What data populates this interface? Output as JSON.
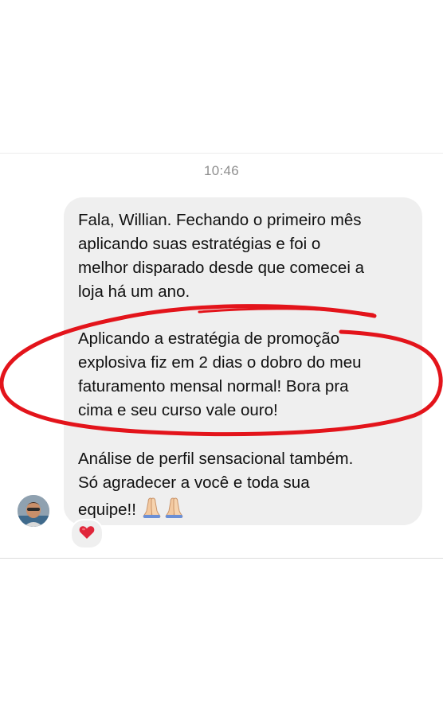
{
  "chat": {
    "timestamp": "10:46",
    "message": {
      "paragraph_1": "Fala, Willian. Fechando o primeiro mês\naplicando suas estratégias e foi o\nmelhor disparado desde que comecei a\nloja há um ano.",
      "paragraph_2": "Aplicando a estratégia de promoção\nexplosiva fiz em 2 dias o dobro do meu\nfaturamento mensal normal! Bora pra\ncima e seu curso vale ouro!",
      "paragraph_3": "Análise de perfil sensacional também.\nSó agradecer a você e toda sua\nequipe!!",
      "emoji_icons": [
        "folded-hands-icon",
        "folded-hands-icon"
      ]
    },
    "reaction": {
      "icon": "red-heart-icon",
      "color": "#e0263a"
    }
  },
  "annotation": {
    "shape": "hand-drawn-oval",
    "color": "#e3141b"
  },
  "colors": {
    "bubble_bg": "#efefef",
    "text": "#111111",
    "timestamp": "#8e8e8e"
  }
}
